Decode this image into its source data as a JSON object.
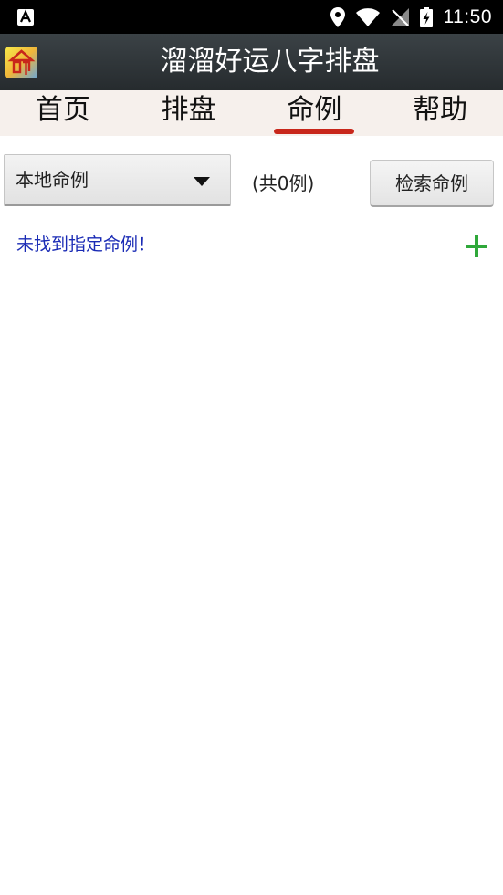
{
  "status_bar": {
    "time": "11:50"
  },
  "app": {
    "title": "溜溜好运八字排盘",
    "icon_glyph": "命"
  },
  "tabs": [
    {
      "label": "首页",
      "active": false
    },
    {
      "label": "排盘",
      "active": false
    },
    {
      "label": "命例",
      "active": true
    },
    {
      "label": "帮助",
      "active": false
    }
  ],
  "controls": {
    "dropdown_value": "本地命例",
    "count_text": "(共0例)",
    "search_label": "检索命例"
  },
  "message": {
    "empty_text": "未找到指定命例！"
  },
  "colors": {
    "accent_red": "#c8271b",
    "message_blue": "#1a2bb5",
    "add_green": "#2fa83a"
  }
}
